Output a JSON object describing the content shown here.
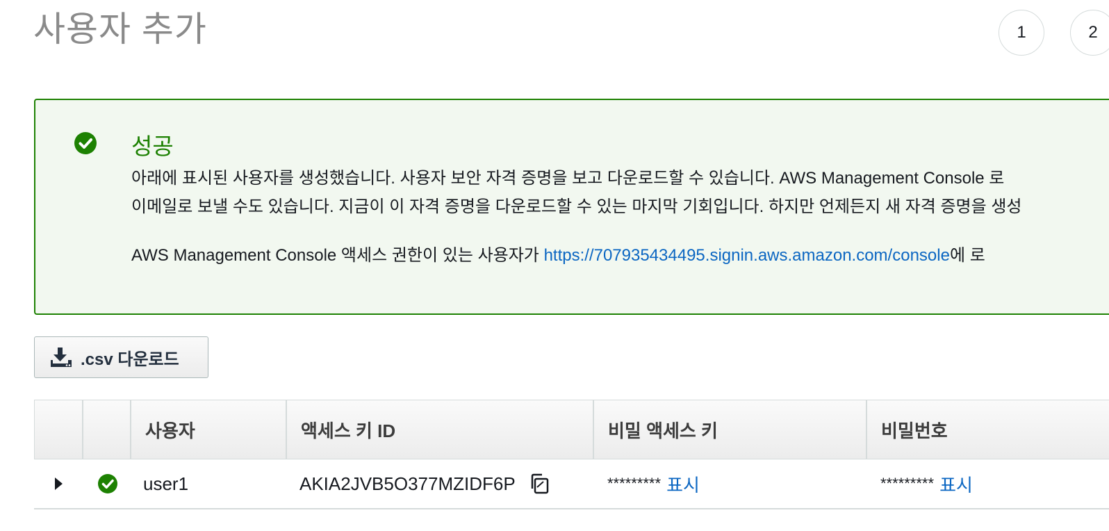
{
  "header": {
    "title": "사용자 추가",
    "steps": [
      "1",
      "2"
    ]
  },
  "alert": {
    "heading": "성공",
    "line1": "아래에 표시된 사용자를 생성했습니다. 사용자 보안 자격 증명을 보고 다운로드할 수 있습니다. AWS Management Console 로",
    "line2": "이메일로 보낼 수도 있습니다. 지금이 이 자격 증명을 다운로드할 수 있는 마지막 기회입니다. 하지만 언제든지 새 자격 증명을 생성",
    "line3_prefix": "AWS Management Console 액세스 권한이 있는 사용자가 ",
    "line3_link": "https://707935434495.signin.aws.amazon.com/console",
    "line3_suffix": "에 로",
    "colors": {
      "border": "#1d8102",
      "background": "#f2f8f0",
      "link": "#0b66c2"
    }
  },
  "toolbar": {
    "csv_download_label": ".csv 다운로드",
    "csv_icon": "download-icon"
  },
  "table": {
    "columns": [
      "",
      "",
      "사용자",
      "액세스 키 ID",
      "비밀 액세스 키",
      "비밀번호"
    ],
    "rows": [
      {
        "user": "user1",
        "access_key_id": "AKIA2JVB5O377MZIDF6P",
        "secret_masked": "*********",
        "secret_show": "표시",
        "password_masked": "*********",
        "password_show": "표시",
        "status_icon": "success-check-icon",
        "expand_icon": "caret-right-icon",
        "copy_icon": "copy-icon"
      }
    ]
  }
}
